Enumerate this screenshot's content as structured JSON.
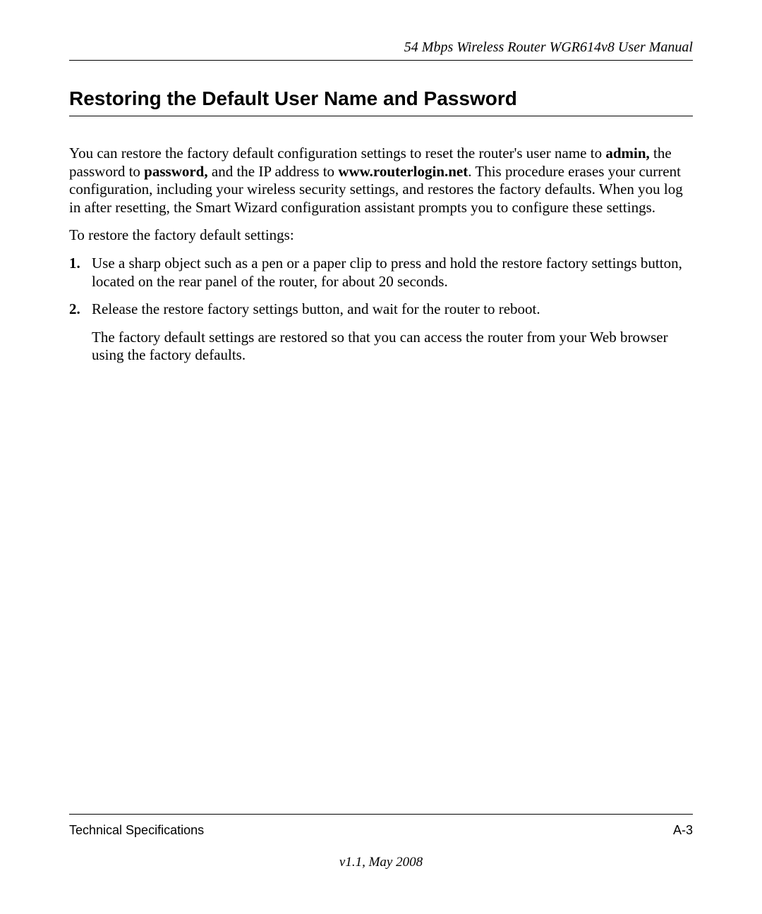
{
  "header": {
    "title": "54 Mbps Wireless Router WGR614v8 User Manual"
  },
  "section": {
    "heading": "Restoring the Default User Name and Password"
  },
  "para1": {
    "p1": "You can restore the factory default configuration settings to reset the router's user name to ",
    "b1": "admin,",
    "p2": " the password to ",
    "b2": "password,",
    "p3": " and the IP address to ",
    "b3": "www.routerlogin.net",
    "p4": ". This procedure erases your current configuration, including your wireless security settings, and restores the factory defaults. When you log in after resetting, the Smart Wizard configuration assistant prompts you to configure these settings."
  },
  "para2": "To restore the factory default settings:",
  "list": {
    "item1": "Use a sharp object such as a pen or a paper clip to press and hold the restore factory settings button, located on the rear panel of the router, for about 20 seconds.",
    "item2": "Release the restore factory settings button, and wait for the router to reboot.",
    "item2_sub": "The factory default settings are restored so that you can access the router from your Web browser using the factory defaults."
  },
  "footer": {
    "left": "Technical Specifications",
    "right": "A-3",
    "version": "v1.1, May 2008"
  }
}
